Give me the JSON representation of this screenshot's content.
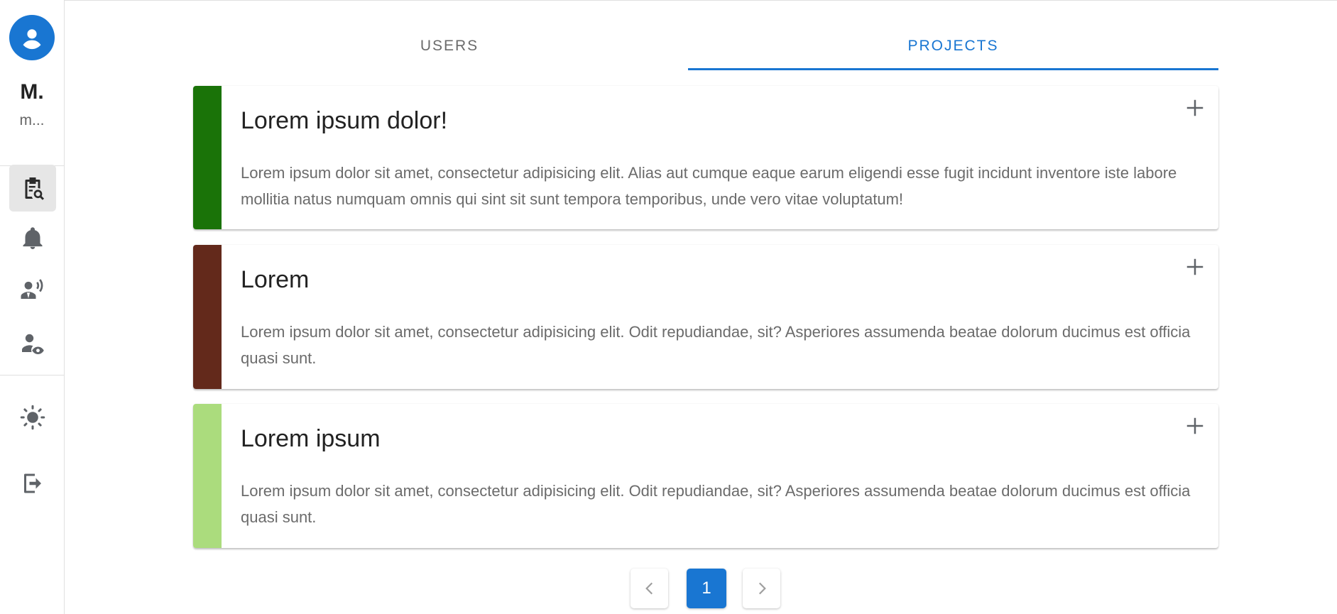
{
  "user": {
    "initial": "M.",
    "email_truncated": "m..."
  },
  "sidebar": {
    "items": [
      {
        "icon": "clipboard-search-icon",
        "active": true
      },
      {
        "icon": "bell-icon",
        "active": false
      },
      {
        "icon": "voice-speaker-icon",
        "active": false
      },
      {
        "icon": "user-eye-icon",
        "active": false
      },
      {
        "icon": "sun-icon",
        "active": false
      },
      {
        "icon": "logout-icon",
        "active": false
      }
    ]
  },
  "tabs": [
    {
      "label": "USERS",
      "selected": false
    },
    {
      "label": "PROJECTS",
      "selected": true
    }
  ],
  "projects": [
    {
      "title": "Lorem ipsum dolor!",
      "description": "Lorem ipsum dolor sit amet, consectetur adipisicing elit. Alias aut cumque eaque earum eligendi esse fugit incidunt inventore iste labore mollitia natus numquam omnis qui sint sit sunt tempora temporibus, unde vero vitae voluptatum!",
      "color": "#1a7308"
    },
    {
      "title": "Lorem",
      "description": "Lorem ipsum dolor sit amet, consectetur adipisicing elit. Odit repudiandae, sit? Asperiores assumenda beatae dolorum ducimus est officia quasi sunt.",
      "color": "#63291b"
    },
    {
      "title": "Lorem ipsum",
      "description": "Lorem ipsum dolor sit amet, consectetur adipisicing elit. Odit repudiandae, sit? Asperiores assumenda beatae dolorum ducimus est officia quasi sunt.",
      "color": "#abdc7d"
    }
  ],
  "pagination": {
    "current_page": "1"
  },
  "colors": {
    "accent": "#1976d2",
    "icon": "#5f6368"
  }
}
